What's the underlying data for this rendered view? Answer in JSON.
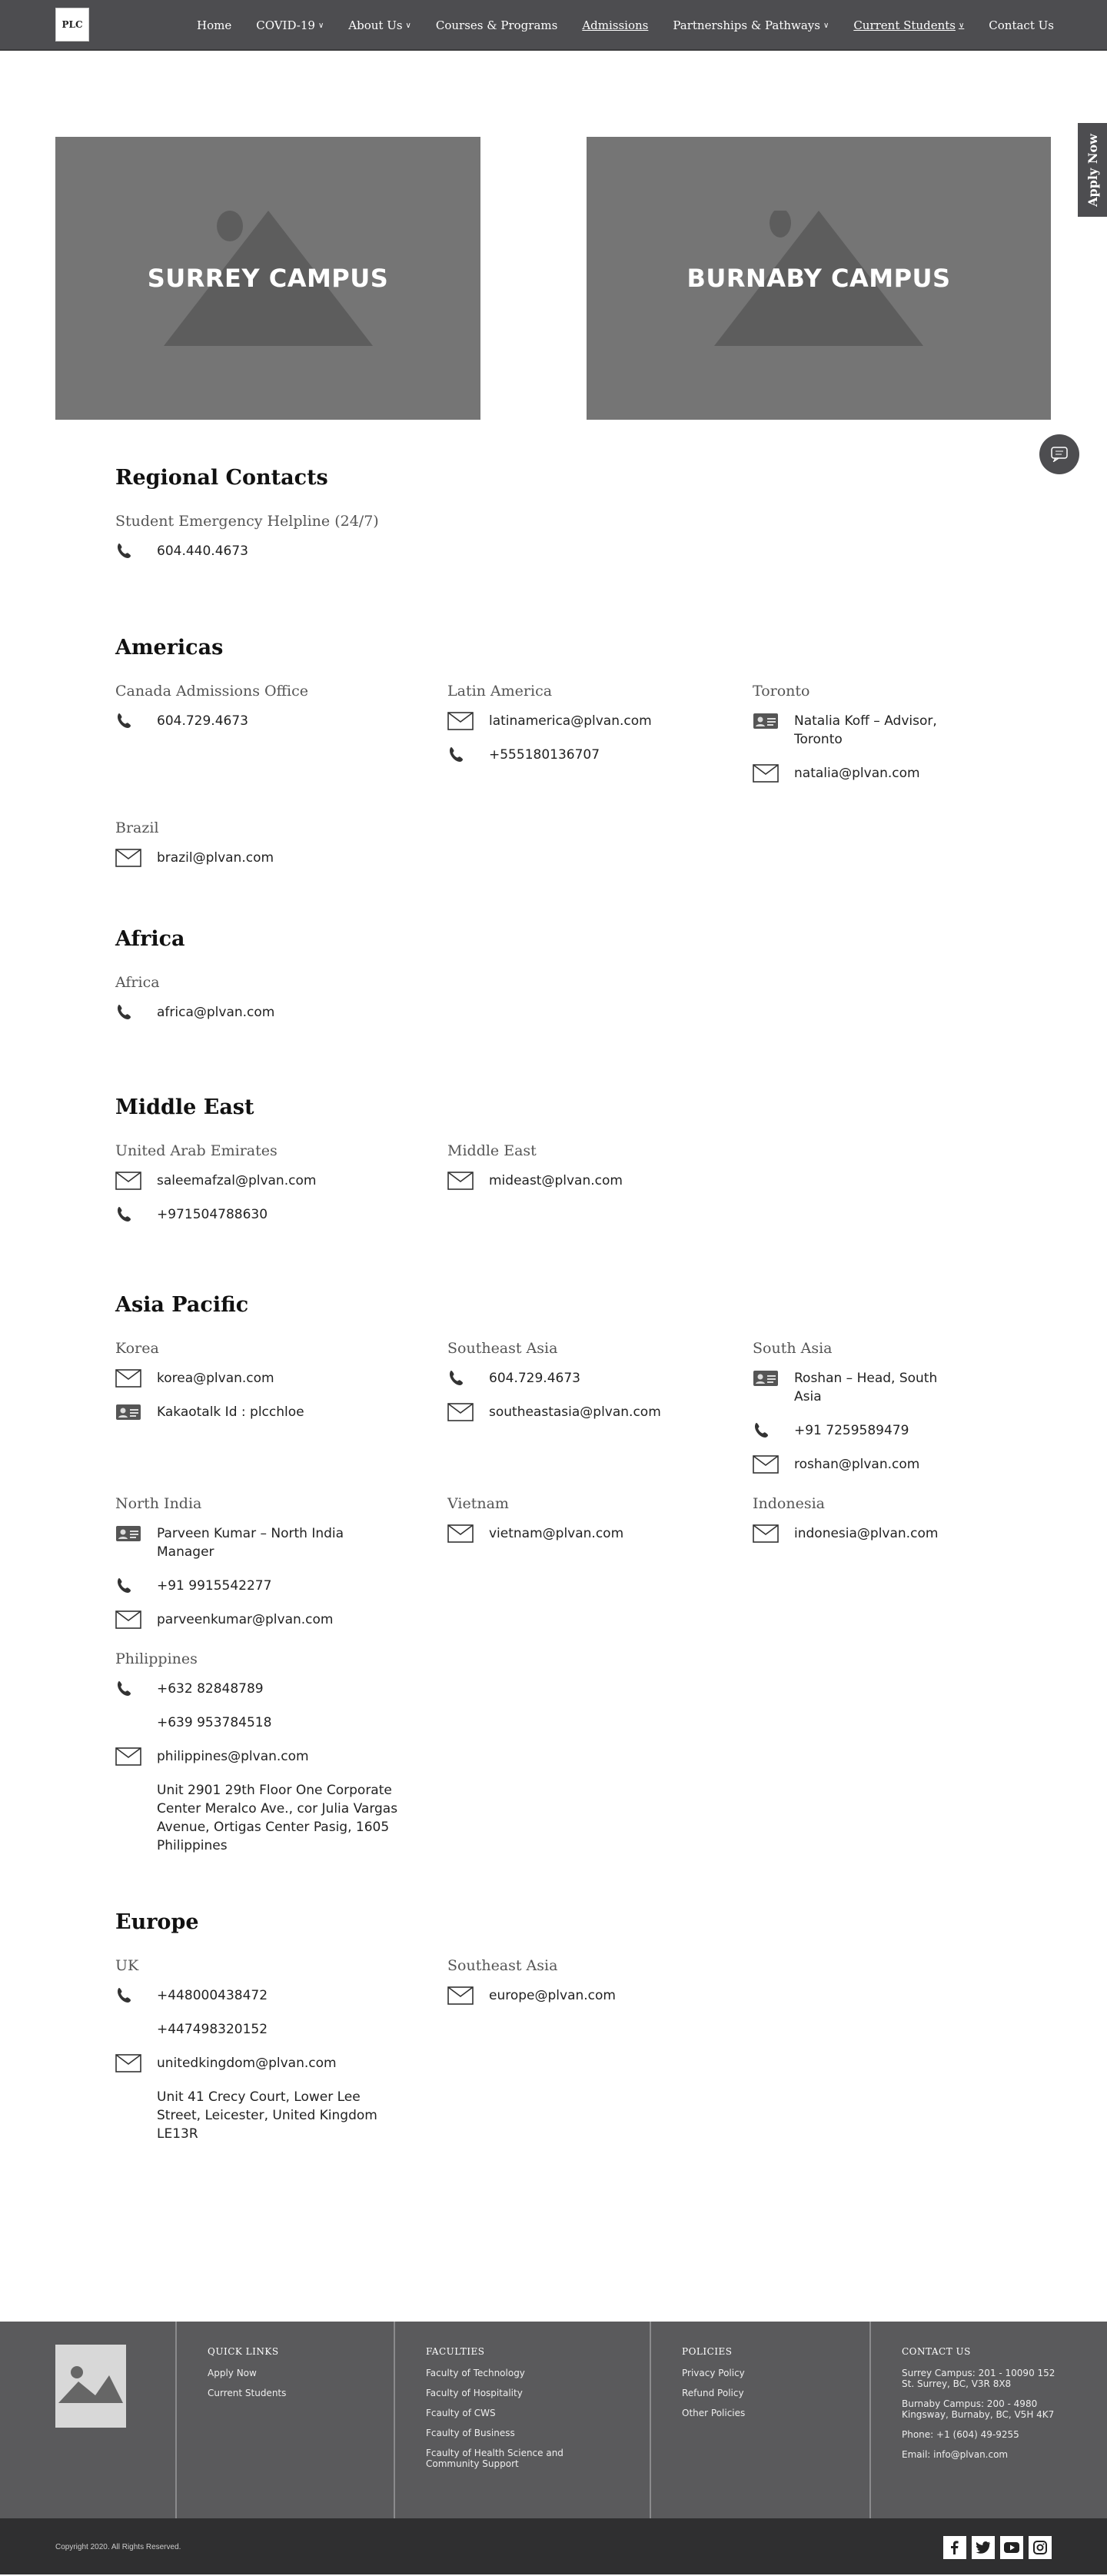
{
  "nav": {
    "logo": "PLC",
    "items": [
      "Home",
      "COVID-19",
      "About Us",
      "Courses & Programs",
      "Admissions",
      "Partnerships & Pathways",
      "Current Students",
      "Contact Us"
    ]
  },
  "campuses": [
    "SURREY CAMPUS",
    "BURNABY CAMPUS"
  ],
  "apply_now": "Apply Now",
  "regional": {
    "title": "Regional Contacts",
    "helpline_label": "Student Emergency Helpline (24/7)",
    "helpline_phone": "604.440.4673"
  },
  "americas": {
    "title": "Americas",
    "canada": {
      "label": "Canada Admissions Office",
      "phone": "604.729.4673"
    },
    "latam": {
      "label": "Latin America",
      "email": "latinamerica@plvan.com",
      "phone": "+555180136707"
    },
    "toronto": {
      "label": "Toronto",
      "contact": "Natalia Koff – Advisor, Toronto",
      "email": "natalia@plvan.com"
    },
    "brazil": {
      "label": "Brazil",
      "email": "brazil@plvan.com"
    }
  },
  "africa": {
    "title": "Africa",
    "label": "Africa",
    "email": "africa@plvan.com"
  },
  "middle_east": {
    "title": "Middle East",
    "uae": {
      "label": "United Arab Emirates",
      "email": "saleemafzal@plvan.com",
      "phone": "+971504788630"
    },
    "me": {
      "label": "Middle East",
      "email": "mideast@plvan.com"
    }
  },
  "asia_pacific": {
    "title": "Asia Pacific",
    "korea": {
      "label": "Korea",
      "email": "korea@plvan.com",
      "kakao": "Kakaotalk Id : plcchloe"
    },
    "sea": {
      "label": "Southeast Asia",
      "phone": "604.729.4673",
      "email": "southeastasia@plvan.com"
    },
    "south_asia": {
      "label": "South Asia",
      "contact": "Roshan – Head, South Asia",
      "phone": "+91 7259589479",
      "email": "roshan@plvan.com"
    },
    "north_india": {
      "label": "North India",
      "contact": "Parveen Kumar – North India Manager",
      "phone": "+91 9915542277",
      "email": "parveenkumar@plvan.com"
    },
    "vietnam": {
      "label": "Vietnam",
      "email": "vietnam@plvan.com"
    },
    "indonesia": {
      "label": "Indonesia",
      "email": "indonesia@plvan.com"
    },
    "philippines": {
      "label": "Philippines",
      "phone1": "+632 82848789",
      "phone2": "+639 953784518",
      "email": "philippines@plvan.com",
      "address": "Unit 2901 29th Floor One Corporate Center Meralco Ave., cor Julia Vargas Avenue, Ortigas Center Pasig, 1605 Philippines"
    }
  },
  "europe": {
    "title": "Europe",
    "uk": {
      "label": "UK",
      "phone1": "+448000438472",
      "phone2": "+447498320152",
      "email": "unitedkingdom@plvan.com",
      "address": "Unit 41 Crecy Court, Lower Lee Street, Leicester, United Kingdom LE13R"
    },
    "sea": {
      "label": "Southeast Asia",
      "email": "europe@plvan.com"
    }
  },
  "footer": {
    "quick_links": {
      "title": "QUICK LINKS",
      "items": [
        "Apply Now",
        "Current Students"
      ]
    },
    "faculties": {
      "title": "FACULTIES",
      "items": [
        "Faculty of Technology",
        "Faculty of  Hospitality",
        "Fcaulty of CWS",
        "Fcaulty of Business",
        "Fcaulty of Health Science and Community Support"
      ]
    },
    "policies": {
      "title": "POLICIES",
      "items": [
        "Privacy Policy",
        "Refund Policy",
        "Other Policies"
      ]
    },
    "contact": {
      "title": "CONTACT US",
      "surrey": "Surrey Campus: 201 - 10090 152 St. Surrey, BC, V3R 8X8",
      "burnaby": "Burnaby Campus: 200 - 4980 Kingsway, Burnaby, BC, V5H 4K7",
      "phone": "Phone: +1 (604) 49-9255",
      "email": "Email: info@plvan.com"
    },
    "copyright": "Copyright 2020. All Rights Reserved.",
    "social": [
      "facebook-icon",
      "twitter-icon",
      "youtube-icon",
      "instagram-icon"
    ]
  }
}
